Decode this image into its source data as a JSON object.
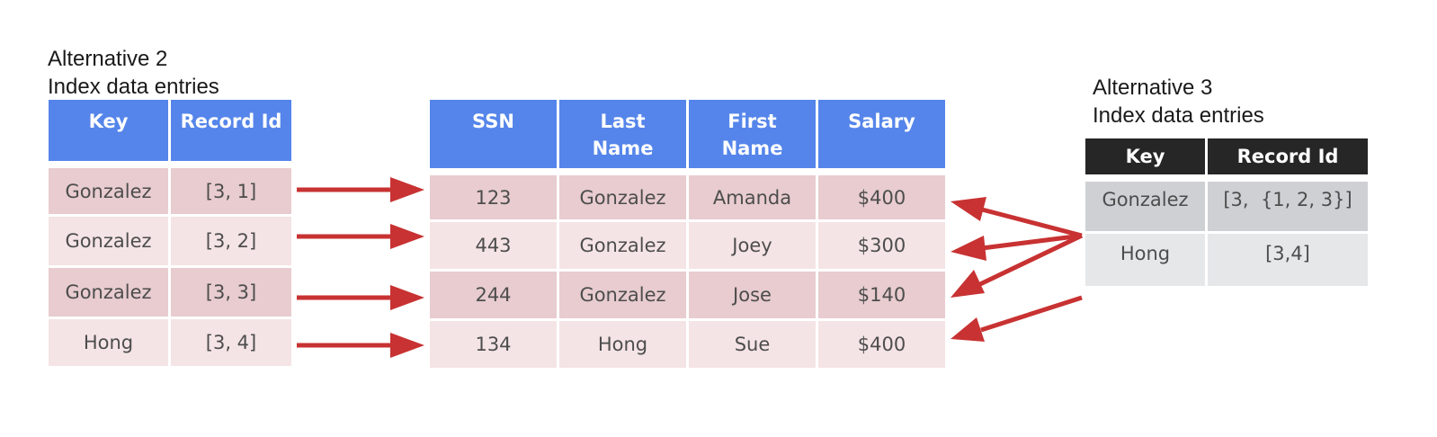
{
  "alt2": {
    "title_line1": "Alternative 2",
    "title_line2": "Index data entries",
    "headers": [
      "Key",
      "Record Id"
    ],
    "rows": [
      [
        "Gonzalez",
        "[3, 1]"
      ],
      [
        "Gonzalez",
        "[3, 2]"
      ],
      [
        "Gonzalez",
        "[3, 3]"
      ],
      [
        "Hong",
        "[3, 4]"
      ]
    ]
  },
  "records": {
    "headers": [
      [
        "SSN"
      ],
      [
        "Last",
        "Name"
      ],
      [
        "First",
        "Name"
      ],
      [
        "Salary"
      ]
    ],
    "rows": [
      [
        "123",
        "Gonzalez",
        "Amanda",
        "$400"
      ],
      [
        "443",
        "Gonzalez",
        "Joey",
        "$300"
      ],
      [
        "244",
        "Gonzalez",
        "Jose",
        "$140"
      ],
      [
        "134",
        "Hong",
        "Sue",
        "$400"
      ]
    ]
  },
  "alt3": {
    "title_line1": "Alternative 3",
    "title_line2": "Index data entries",
    "headers": [
      "Key",
      "Record Id"
    ],
    "rows": [
      [
        "Gonzalez",
        "[3,  {1, 2, 3}]"
      ],
      [
        "Hong",
        "[3,4]"
      ]
    ]
  },
  "colors": {
    "header_blue": "#5585ea",
    "header_dark": "#262626",
    "row_pink_dark": "#e8cccf",
    "row_pink_light": "#f5e4e5",
    "row_gray_dark": "#cfd0d4",
    "row_gray_light": "#e6e7e9",
    "arrow_red": "#c83232"
  }
}
